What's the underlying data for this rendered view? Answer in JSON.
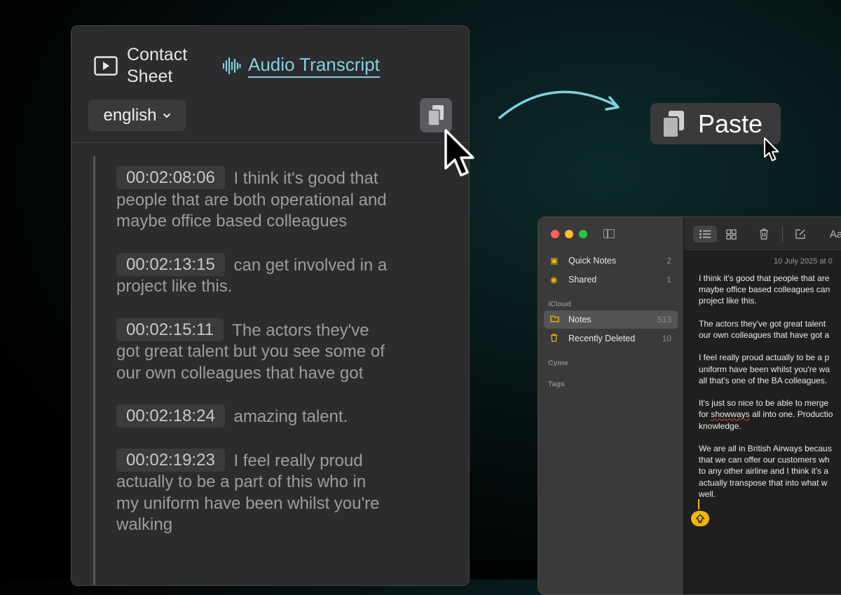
{
  "transcript_panel": {
    "tabs": {
      "contact_sheet": "Contact Sheet",
      "audio_transcript": "Audio Transcript"
    },
    "language": "english",
    "entries": [
      {
        "timestamp": "00:02:08:06",
        "text": "I think it's good that people that are both operational and maybe office based colleagues"
      },
      {
        "timestamp": "00:02:13:15",
        "text": "can get involved in a project like this."
      },
      {
        "timestamp": "00:02:15:11",
        "text": "The actors they've got great talent but you see some of our own colleagues that have got"
      },
      {
        "timestamp": "00:02:18:24",
        "text": "amazing talent."
      },
      {
        "timestamp": "00:02:19:23",
        "text": "I feel really proud actually to be a part of this who in my uniform have been whilst you're walking"
      }
    ]
  },
  "paste_label": "Paste",
  "notes_app": {
    "sidebar": {
      "items": [
        {
          "label": "Quick Notes",
          "count": "2"
        },
        {
          "label": "Shared",
          "count": "1"
        }
      ],
      "icloud_header": "iCloud",
      "icloud_items": [
        {
          "label": "Notes",
          "count": "513"
        },
        {
          "label": "Recently Deleted",
          "count": "10"
        }
      ],
      "section_cyme": "Cyme",
      "section_tags": "Tags"
    },
    "toolbar": {
      "font_label": "Aa"
    },
    "note": {
      "date": "10 July 2025 at 0",
      "lines": [
        "I think it's good that people that are",
        "maybe office based colleagues can",
        "project like this.",
        "The actors they've got great talent",
        "our own colleagues that have got a",
        "I feel really proud actually to be a p",
        "uniform have been whilst you're wa",
        "all that's one of the BA colleagues.",
        "It's just so nice to be able to merge",
        "for",
        "showways",
        "all into one. Productio",
        "knowledge.",
        "We are all in British Airways becaus",
        "that we can offer our customers wh",
        "to any other airline and I think it's a",
        "actually transpose that into what w",
        "well."
      ]
    }
  },
  "colors": {
    "accent": "#7fd2e0",
    "notes_yellow": "#f5b800"
  }
}
